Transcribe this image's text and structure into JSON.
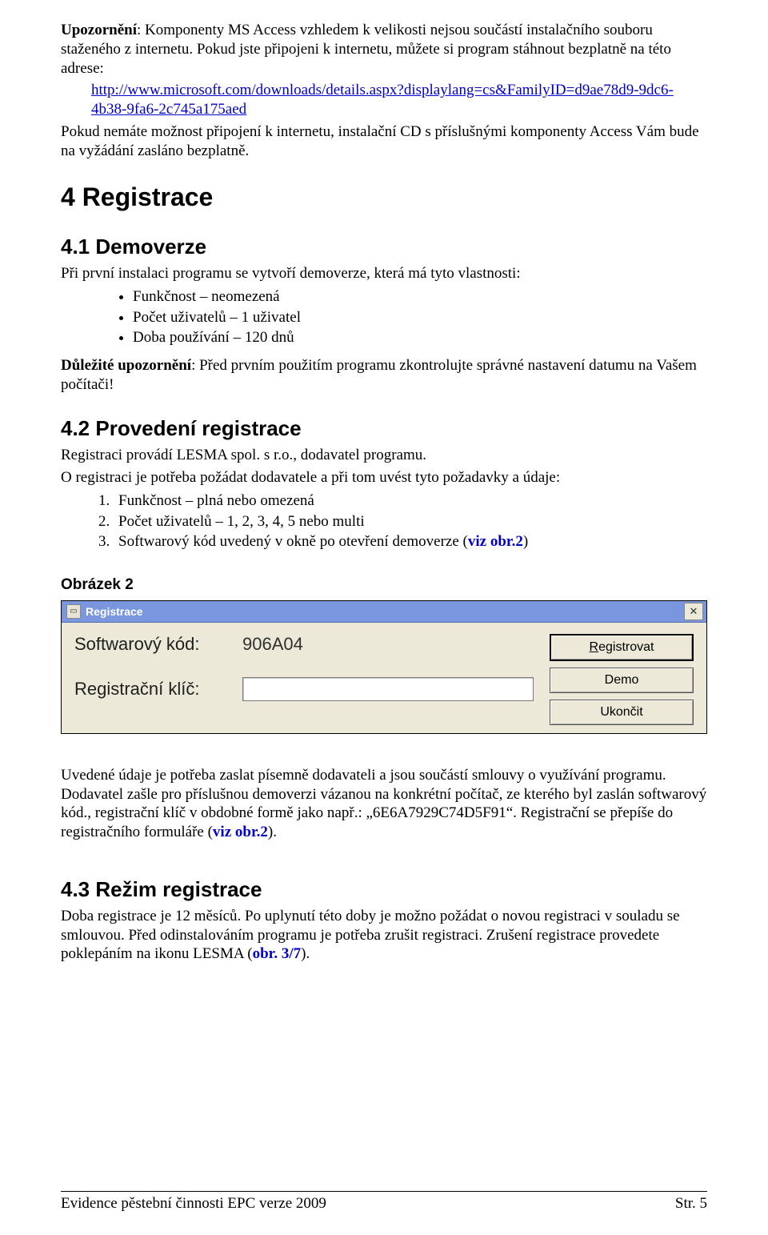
{
  "intro": {
    "p1": "Upozornění: Komponenty MS Access vzhledem k velikosti nejsou součástí instalačního souboru staženého z internetu. Pokud jste připojeni k internetu, můžete si program stáhnout bezplatně na této adrese:",
    "link1": "http://www.microsoft.com/downloads/details.aspx?displaylang=cs&FamilyID=d9ae78d9-9dc6-4b38-9fa6-2c745a175aed",
    "p2": "Pokud nemáte možnost připojení k internetu, instalační CD s příslušnými komponenty Access Vám bude na vyžádání zasláno bezplatně."
  },
  "s4": {
    "title": "4  Registrace",
    "s41": {
      "title": "4.1  Demoverze",
      "lead": "Při první instalaci programu se vytvoří demoverze, která má tyto vlastnosti:",
      "b1": "Funkčnost – neomezená",
      "b2": "Počet uživatelů – 1 uživatel",
      "b3": "Doba používání – 120 dnů",
      "note_lead": "Důležité upozornění",
      "note_rest": ": Před prvním použitím programu zkontrolujte správné nastavení datumu na Vašem počítači!"
    },
    "s42": {
      "title": "4.2  Provedení registrace",
      "p1": "Registraci provádí LESMA spol. s r.o., dodavatel programu.",
      "p2": "O registraci je potřeba požádat dodavatele a při tom uvést tyto požadavky a údaje:",
      "n1": "Funkčnost – plná nebo omezená",
      "n2": "Počet uživatelů – 1, 2, 3, 4, 5 nebo multi",
      "n3_a": "Softwarový kód uvedený v okně po otevření demoverze (",
      "n3_ref": "viz obr.2",
      "n3_b": ")",
      "caption": "Obrázek 2",
      "after_a": "Uvedené údaje je potřeba zaslat písemně dodavateli a jsou součástí smlouvy o využívání programu. Dodavatel zašle pro příslušnou demoverzi vázanou na konkrétní počítač, ze kterého byl zaslán softwarový kód., registrační klíč v obdobné formě jako např.: „6E6A7929C74D5F91“. Registrační se přepíše do registračního formuláře (",
      "after_ref": "viz obr.2",
      "after_b": ")."
    },
    "s43": {
      "title": "4.3  Režim registrace",
      "p_a": "Doba registrace je 12 měsíců. Po uplynutí této doby je možno požádat o novou registraci v souladu se smlouvou. Před odinstalováním programu je potřeba zrušit registraci. Zrušení registrace provedete poklepáním na ikonu LESMA (",
      "p_ref": "obr. 3/7",
      "p_b": ")."
    }
  },
  "dialog": {
    "title": "Registrace",
    "lbl_code": "Softwarový kód:",
    "code_value": "906A04",
    "lbl_key": "Registrační klíč:",
    "btn_register_pre": "R",
    "btn_register_rest": "egistrovat",
    "btn_demo": "Demo",
    "btn_close": "Ukončit"
  },
  "footer": {
    "left": "Evidence pěstební činnosti   EPC verze 2009",
    "right": "Str. 5"
  }
}
